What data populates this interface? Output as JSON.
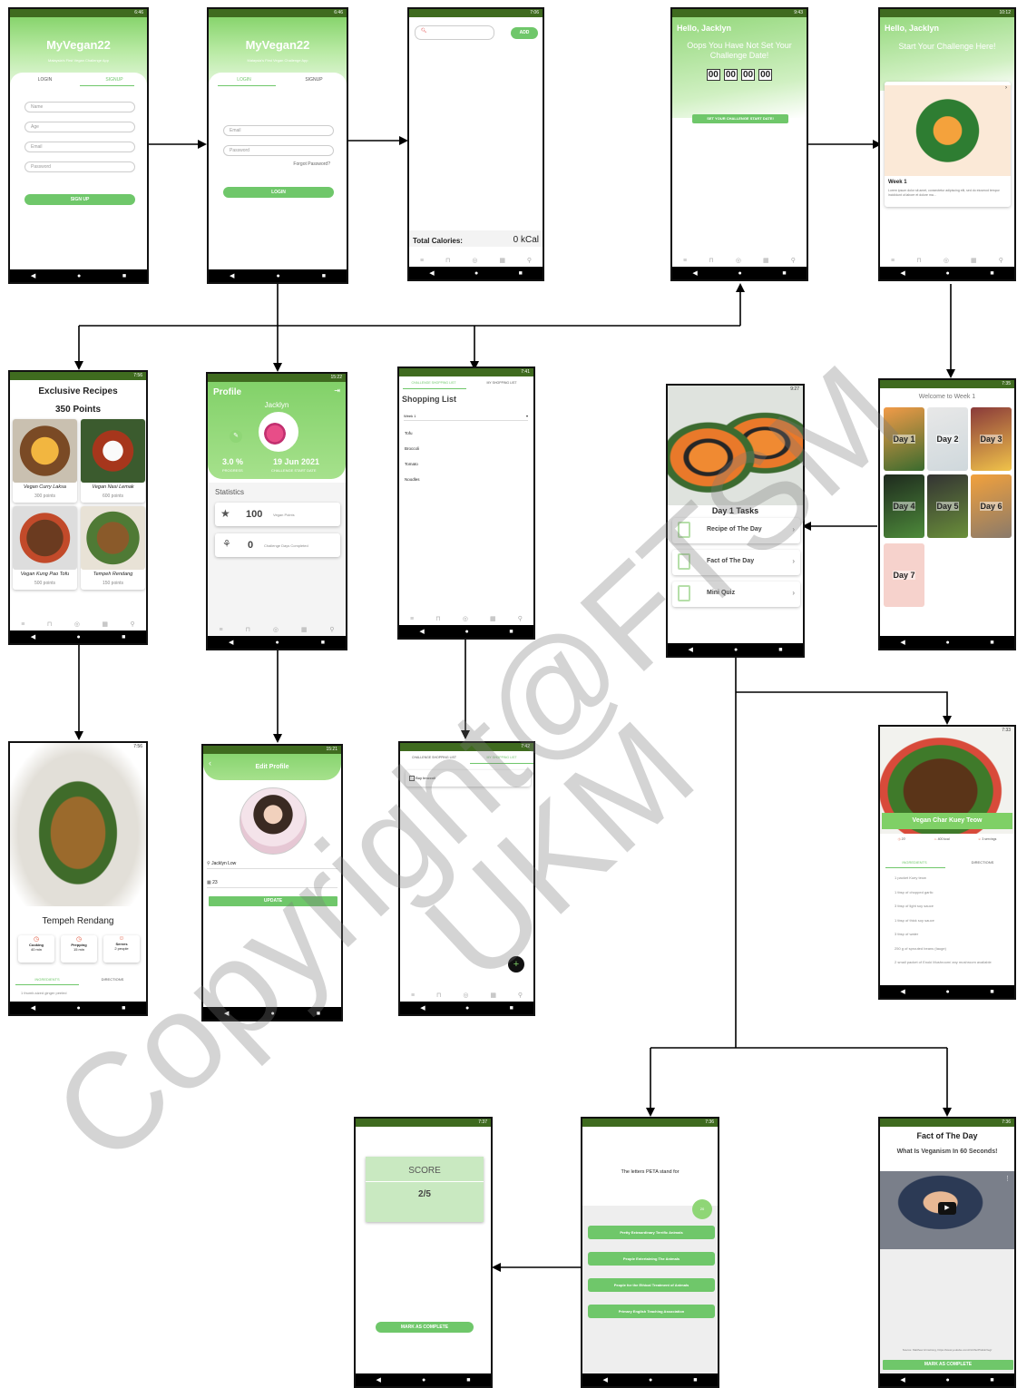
{
  "app": {
    "name": "MyVegan22",
    "tagline": "Malaysia's First Vegan Challenge App",
    "user_greeting": "Hello, Jacklyn",
    "user_name": "Jacklyn"
  },
  "statusbar": {
    "signup_time": "6:46",
    "login_time": "6:46",
    "calories_time": "7:06",
    "home_empty_time": "9:43",
    "home_challenge_time": "10:12",
    "recipes_time": "7:56",
    "profile_time": "15:22",
    "shopping_time": "7:41",
    "day_time": "9:27",
    "week_time": "7:35",
    "recipe_detail_time": "7:56",
    "edit_profile_time": "15:21",
    "myshopping_time": "7:42",
    "koay_time": "7:33",
    "score_time": "7:37",
    "quiz_time": "7:36",
    "fact_time": "7:36"
  },
  "nav": {
    "back": "◀",
    "home": "●",
    "recent": "■"
  },
  "bottom_nav_icons": [
    "menu-icon",
    "cart-icon",
    "compass-icon",
    "calendar-icon",
    "user-icon"
  ],
  "signup": {
    "tab_login": "LOGIN",
    "tab_signup": "SIGNUP",
    "name_placeholder": "Name",
    "age_placeholder": "Age",
    "email_placeholder": "Email",
    "password_placeholder": "Password",
    "button": "SIGN UP"
  },
  "login": {
    "tab_login": "LOGIN",
    "tab_signup": "SIGNUP",
    "email_placeholder": "Email",
    "password_placeholder": "Password",
    "forgot": "Forgot Password?",
    "button": "LOGIN"
  },
  "calories": {
    "add_button": "ADD",
    "total_label": "Total Calories:",
    "total_value": "0 kCal"
  },
  "home_empty": {
    "message": "Oops You Have Not Set Your Challenge Date!",
    "countdown": [
      "00",
      "00",
      "00",
      "00"
    ],
    "button": "SET YOUR CHALLENGE START DATE!"
  },
  "home_challenge": {
    "message": "Start Your Challenge Here!",
    "card_title": "Week 1",
    "card_text": "Lorem ipsum dolor sit amet, consectetur adipiscing elit, sed do eiusmod tempor incididunt ut labore et dolore ma..."
  },
  "recipes": {
    "title": "Exclusive Recipes",
    "points": "350 Points",
    "items": [
      {
        "name": "Vegan Curry Laksa",
        "points": "300 points"
      },
      {
        "name": "Vegan Nasi Lemak",
        "points": "600 points"
      },
      {
        "name": "Vegan Kung Pao Tofu",
        "points": "500 points"
      },
      {
        "name": "Tempeh Rendang",
        "points": "150 points"
      }
    ]
  },
  "profile": {
    "title": "Profile",
    "progress_value": "3.0 %",
    "progress_label": "PROGRESS",
    "date_value": "19 Jun 2021",
    "date_label": "CHALLENGE START DATE",
    "statistics_label": "Statistics",
    "stat_points_value": "100",
    "stat_points_label": "Vegan Points",
    "stat_days_value": "0",
    "stat_days_label": "Challenge Days Completed"
  },
  "shopping": {
    "tab_challenge": "CHALLENGE SHOPPING LIST",
    "tab_mine": "MY SHOPPING LIST",
    "title": "Shopping List",
    "week": "Week 1",
    "items": [
      "Tofu",
      "Broccoli",
      "Tomato",
      "Noodles"
    ]
  },
  "day": {
    "title": "Day 1 Tasks",
    "tasks": [
      "Recipe of The Day",
      "Fact of The Day",
      "Mini Quiz"
    ]
  },
  "week": {
    "title": "Welcome to Week 1",
    "days": [
      "Day 1",
      "Day 2",
      "Day 3",
      "Day 4",
      "Day 5",
      "Day 6",
      "Day 7"
    ]
  },
  "recipe_detail": {
    "title": "Tempeh Rendang",
    "cooking_label": "Cooking",
    "cooking_value": "40 min",
    "prep_label": "Prepping",
    "prep_value": "15 min",
    "serves_label": "Serves",
    "serves_value": "2 people",
    "tab_ingredients": "INGREDIENTS",
    "tab_directions": "DIRECTIONS",
    "first_ingredient": "1 thumb-sized ginger peeled"
  },
  "edit_profile": {
    "title": "Edit Profile",
    "name_value": "Jacklyn Low",
    "age_value": "23",
    "button": "UPDATE"
  },
  "myshopping": {
    "tab_challenge": "CHALLENGE SHOPPING LIST",
    "tab_mine": "MY SHOPPING LIST",
    "item": "Buy broccoli",
    "fab": "+"
  },
  "koay": {
    "title": "Vegan Char Kuey Teow",
    "time": "20'",
    "kcal": "400 kcal",
    "servings": "3 servings",
    "tab_ingredients": "INGREDIENTS",
    "tab_directions": "DIRECTIONS",
    "ingredients": [
      "1 packet Kuey teow",
      "1 tbsp of chopped garlic",
      "3 tbsp of light soy sauce",
      "1 tbsp of thick soy sauce",
      "3 tbsp of water",
      "250 g of sprouted beans (tauge)",
      "2 small packet of Enoki Mushroom/ any mushroom available"
    ]
  },
  "score": {
    "label": "SCORE",
    "value": "2/5",
    "button": "MARK AS COMPLETE"
  },
  "quiz": {
    "question": "The letters PETA stand for",
    "timer": "20",
    "options": [
      "Pretty Extraordinary Terrific Animals",
      "People Entertaining The Animals",
      "People for the Ethical Treatment of Animals",
      "Primary English Teaching Association"
    ]
  },
  "fact": {
    "title": "Fact of The Day",
    "subtitle": "What Is Veganism In 60 Seconds!",
    "source": "Source: Matthew Armstrong, https://www.youtube.com/c/ArthurPlotkinVeg/",
    "button": "MARK AS COMPLETE"
  },
  "watermark": {
    "line1": "Copyright@FTSM",
    "line2": "UKM"
  }
}
